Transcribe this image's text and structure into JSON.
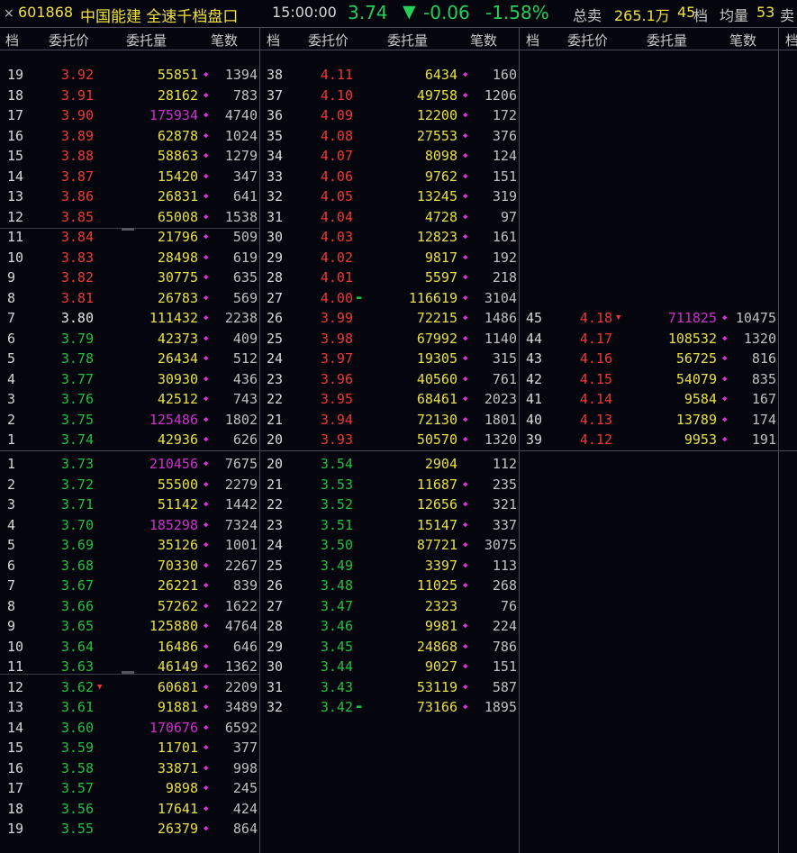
{
  "header": {
    "close": "×",
    "code": "601868",
    "name": "中国能建 全速千档盘口",
    "time": "15:00:00",
    "price": "3.74",
    "arrow": "▼",
    "change": "-0.06",
    "change_pct": "-1.58%",
    "total_sell_label": "总卖",
    "total_sell_value": "265.1万",
    "levels_count": "45",
    "levels_label": "档",
    "avg_label": "均量",
    "avg_value": "53",
    "truncated": "卖"
  },
  "columns": {
    "level": "档",
    "price": "委托价",
    "volume": "委托量",
    "count": "笔数"
  },
  "colors": {
    "up": "#f03838",
    "down": "#22c040",
    "flat": "#e8e8e8",
    "volume": "#e8e040",
    "large_volume": "#d030d0",
    "dot": "#e030e0"
  },
  "asks": {
    "col1": [
      {
        "lv": "19",
        "price": "3.92",
        "vol": "55851",
        "cnt": "1394",
        "pc": "red"
      },
      {
        "lv": "18",
        "price": "3.91",
        "vol": "28162",
        "cnt": "783",
        "pc": "red"
      },
      {
        "lv": "17",
        "price": "3.90",
        "vol": "175934",
        "cnt": "4740",
        "pc": "red",
        "big": true
      },
      {
        "lv": "16",
        "price": "3.89",
        "vol": "62878",
        "cnt": "1024",
        "pc": "red"
      },
      {
        "lv": "15",
        "price": "3.88",
        "vol": "58863",
        "cnt": "1279",
        "pc": "red"
      },
      {
        "lv": "14",
        "price": "3.87",
        "vol": "15420",
        "cnt": "347",
        "pc": "red"
      },
      {
        "lv": "13",
        "price": "3.86",
        "vol": "26831",
        "cnt": "641",
        "pc": "red"
      },
      {
        "lv": "12",
        "price": "3.85",
        "vol": "65008",
        "cnt": "1538",
        "pc": "red"
      },
      {
        "lv": "11",
        "price": "3.84",
        "vol": "21796",
        "cnt": "509",
        "pc": "red"
      },
      {
        "lv": "10",
        "price": "3.83",
        "vol": "28498",
        "cnt": "619",
        "pc": "red"
      },
      {
        "lv": "9",
        "price": "3.82",
        "vol": "30775",
        "cnt": "635",
        "pc": "red"
      },
      {
        "lv": "8",
        "price": "3.81",
        "vol": "26783",
        "cnt": "569",
        "pc": "red"
      },
      {
        "lv": "7",
        "price": "3.80",
        "vol": "111432",
        "cnt": "2238",
        "pc": "wht"
      },
      {
        "lv": "6",
        "price": "3.79",
        "vol": "42373",
        "cnt": "409",
        "pc": "grn"
      },
      {
        "lv": "5",
        "price": "3.78",
        "vol": "26434",
        "cnt": "512",
        "pc": "grn"
      },
      {
        "lv": "4",
        "price": "3.77",
        "vol": "30930",
        "cnt": "436",
        "pc": "grn"
      },
      {
        "lv": "3",
        "price": "3.76",
        "vol": "42512",
        "cnt": "743",
        "pc": "grn"
      },
      {
        "lv": "2",
        "price": "3.75",
        "vol": "125486",
        "cnt": "1802",
        "pc": "grn",
        "big": true
      },
      {
        "lv": "1",
        "price": "3.74",
        "vol": "42936",
        "cnt": "626",
        "pc": "grn"
      }
    ],
    "col2": [
      {
        "lv": "38",
        "price": "4.11",
        "vol": "6434",
        "cnt": "160",
        "pc": "red"
      },
      {
        "lv": "37",
        "price": "4.10",
        "vol": "49758",
        "cnt": "1206",
        "pc": "red"
      },
      {
        "lv": "36",
        "price": "4.09",
        "vol": "12200",
        "cnt": "172",
        "pc": "red"
      },
      {
        "lv": "35",
        "price": "4.08",
        "vol": "27553",
        "cnt": "376",
        "pc": "red"
      },
      {
        "lv": "34",
        "price": "4.07",
        "vol": "8098",
        "cnt": "124",
        "pc": "red"
      },
      {
        "lv": "33",
        "price": "4.06",
        "vol": "9762",
        "cnt": "151",
        "pc": "red"
      },
      {
        "lv": "32",
        "price": "4.05",
        "vol": "13245",
        "cnt": "319",
        "pc": "red"
      },
      {
        "lv": "31",
        "price": "4.04",
        "vol": "4728",
        "cnt": "97",
        "pc": "red"
      },
      {
        "lv": "30",
        "price": "4.03",
        "vol": "12823",
        "cnt": "161",
        "pc": "red"
      },
      {
        "lv": "29",
        "price": "4.02",
        "vol": "9817",
        "cnt": "192",
        "pc": "red"
      },
      {
        "lv": "28",
        "price": "4.01",
        "vol": "5597",
        "cnt": "218",
        "pc": "red"
      },
      {
        "lv": "27",
        "price": "4.00",
        "vol": "116619",
        "cnt": "3104",
        "pc": "red",
        "mk": "g"
      },
      {
        "lv": "26",
        "price": "3.99",
        "vol": "72215",
        "cnt": "1486",
        "pc": "red"
      },
      {
        "lv": "25",
        "price": "3.98",
        "vol": "67992",
        "cnt": "1140",
        "pc": "red"
      },
      {
        "lv": "24",
        "price": "3.97",
        "vol": "19305",
        "cnt": "315",
        "pc": "red"
      },
      {
        "lv": "23",
        "price": "3.96",
        "vol": "40560",
        "cnt": "761",
        "pc": "red"
      },
      {
        "lv": "22",
        "price": "3.95",
        "vol": "68461",
        "cnt": "2023",
        "pc": "red"
      },
      {
        "lv": "21",
        "price": "3.94",
        "vol": "72130",
        "cnt": "1801",
        "pc": "red"
      },
      {
        "lv": "20",
        "price": "3.93",
        "vol": "50570",
        "cnt": "1320",
        "pc": "red"
      }
    ],
    "col3": [
      {
        "lv": "45",
        "price": "4.18",
        "vol": "711825",
        "cnt": "10475",
        "pc": "red",
        "big": true,
        "mk": "r"
      },
      {
        "lv": "44",
        "price": "4.17",
        "vol": "108532",
        "cnt": "1320",
        "pc": "red"
      },
      {
        "lv": "43",
        "price": "4.16",
        "vol": "56725",
        "cnt": "816",
        "pc": "red"
      },
      {
        "lv": "42",
        "price": "4.15",
        "vol": "54079",
        "cnt": "835",
        "pc": "red"
      },
      {
        "lv": "41",
        "price": "4.14",
        "vol": "9584",
        "cnt": "167",
        "pc": "red"
      },
      {
        "lv": "40",
        "price": "4.13",
        "vol": "13789",
        "cnt": "174",
        "pc": "red"
      },
      {
        "lv": "39",
        "price": "4.12",
        "vol": "9953",
        "cnt": "191",
        "pc": "red"
      }
    ]
  },
  "bids": {
    "col1": [
      {
        "lv": "1",
        "price": "3.73",
        "vol": "210456",
        "cnt": "7675",
        "pc": "grn",
        "big": true
      },
      {
        "lv": "2",
        "price": "3.72",
        "vol": "55500",
        "cnt": "2279",
        "pc": "grn"
      },
      {
        "lv": "3",
        "price": "3.71",
        "vol": "51142",
        "cnt": "1442",
        "pc": "grn"
      },
      {
        "lv": "4",
        "price": "3.70",
        "vol": "185298",
        "cnt": "7324",
        "pc": "grn",
        "big": true
      },
      {
        "lv": "5",
        "price": "3.69",
        "vol": "35126",
        "cnt": "1001",
        "pc": "grn"
      },
      {
        "lv": "6",
        "price": "3.68",
        "vol": "70330",
        "cnt": "2267",
        "pc": "grn"
      },
      {
        "lv": "7",
        "price": "3.67",
        "vol": "26221",
        "cnt": "839",
        "pc": "grn"
      },
      {
        "lv": "8",
        "price": "3.66",
        "vol": "57262",
        "cnt": "1622",
        "pc": "grn"
      },
      {
        "lv": "9",
        "price": "3.65",
        "vol": "125880",
        "cnt": "4764",
        "pc": "grn"
      },
      {
        "lv": "10",
        "price": "3.64",
        "vol": "16486",
        "cnt": "646",
        "pc": "grn"
      },
      {
        "lv": "11",
        "price": "3.63",
        "vol": "46149",
        "cnt": "1362",
        "pc": "grn"
      },
      {
        "lv": "12",
        "price": "3.62",
        "vol": "60681",
        "cnt": "2209",
        "pc": "grn",
        "mk": "r"
      },
      {
        "lv": "13",
        "price": "3.61",
        "vol": "91881",
        "cnt": "3489",
        "pc": "grn"
      },
      {
        "lv": "14",
        "price": "3.60",
        "vol": "170676",
        "cnt": "6592",
        "pc": "grn",
        "big": true
      },
      {
        "lv": "15",
        "price": "3.59",
        "vol": "11701",
        "cnt": "377",
        "pc": "grn"
      },
      {
        "lv": "16",
        "price": "3.58",
        "vol": "33871",
        "cnt": "998",
        "pc": "grn"
      },
      {
        "lv": "17",
        "price": "3.57",
        "vol": "9898",
        "cnt": "245",
        "pc": "grn"
      },
      {
        "lv": "18",
        "price": "3.56",
        "vol": "17641",
        "cnt": "424",
        "pc": "grn"
      },
      {
        "lv": "19",
        "price": "3.55",
        "vol": "26379",
        "cnt": "864",
        "pc": "grn"
      }
    ],
    "col2": [
      {
        "lv": "20",
        "price": "3.54",
        "vol": "2904",
        "cnt": "112",
        "pc": "grn",
        "nodot": true
      },
      {
        "lv": "21",
        "price": "3.53",
        "vol": "11687",
        "cnt": "235",
        "pc": "grn"
      },
      {
        "lv": "22",
        "price": "3.52",
        "vol": "12656",
        "cnt": "321",
        "pc": "grn"
      },
      {
        "lv": "23",
        "price": "3.51",
        "vol": "15147",
        "cnt": "337",
        "pc": "grn"
      },
      {
        "lv": "24",
        "price": "3.50",
        "vol": "87721",
        "cnt": "3075",
        "pc": "grn"
      },
      {
        "lv": "25",
        "price": "3.49",
        "vol": "3397",
        "cnt": "113",
        "pc": "grn"
      },
      {
        "lv": "26",
        "price": "3.48",
        "vol": "11025",
        "cnt": "268",
        "pc": "grn"
      },
      {
        "lv": "27",
        "price": "3.47",
        "vol": "2323",
        "cnt": "76",
        "pc": "grn",
        "nodot": true
      },
      {
        "lv": "28",
        "price": "3.46",
        "vol": "9981",
        "cnt": "224",
        "pc": "grn"
      },
      {
        "lv": "29",
        "price": "3.45",
        "vol": "24868",
        "cnt": "786",
        "pc": "grn"
      },
      {
        "lv": "30",
        "price": "3.44",
        "vol": "9027",
        "cnt": "151",
        "pc": "grn"
      },
      {
        "lv": "31",
        "price": "3.43",
        "vol": "53119",
        "cnt": "587",
        "pc": "grn"
      },
      {
        "lv": "32",
        "price": "3.42",
        "vol": "73166",
        "cnt": "1895",
        "pc": "grn",
        "mk": "g"
      }
    ]
  }
}
